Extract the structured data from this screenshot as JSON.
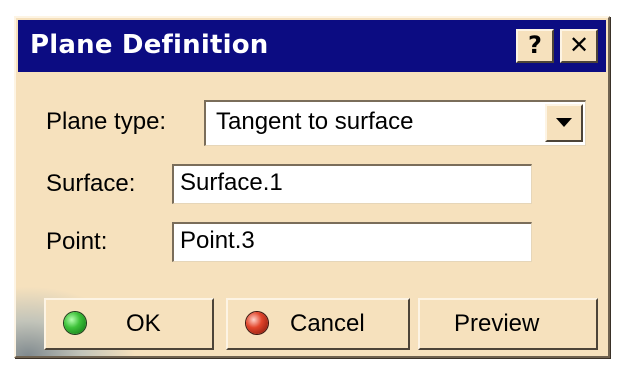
{
  "window": {
    "title": "Plane Definition",
    "help_label": "?",
    "close_label": "✕"
  },
  "form": {
    "plane_type": {
      "label": "Plane type:",
      "selected": "Tangent to surface"
    },
    "surface": {
      "label": "Surface:",
      "value": "Surface.1"
    },
    "point": {
      "label": "Point:",
      "value": "Point.3"
    }
  },
  "buttons": {
    "ok": {
      "label": "OK",
      "icon": "green-orb-icon"
    },
    "cancel": {
      "label": "Cancel",
      "icon": "red-orb-icon"
    },
    "preview": {
      "label": "Preview"
    }
  },
  "colors": {
    "titlebar": "#0c0c82",
    "dialog_bg": "#f6e1bd",
    "ok_icon": "#3ec23a",
    "cancel_icon": "#e2452b"
  }
}
